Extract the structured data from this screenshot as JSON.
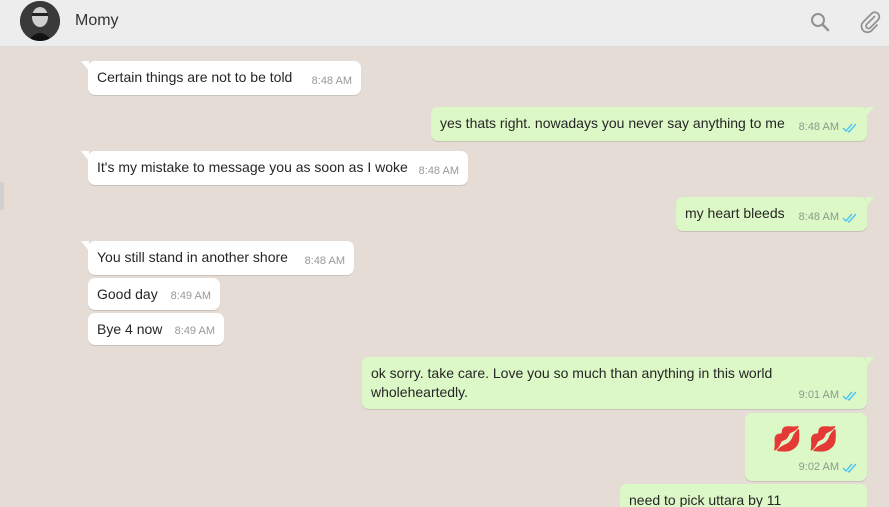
{
  "header": {
    "contact_name": "Momy",
    "icons": [
      "search-icon",
      "attach-icon"
    ]
  },
  "messages": [
    {
      "dir": "in",
      "text": "Certain things are not to be told",
      "time": "8:48 AM"
    },
    {
      "dir": "out",
      "text": "yes thats right. nowadays you never say anything to me",
      "time": "8:48 AM",
      "status": "read"
    },
    {
      "dir": "in",
      "text": "It's my mistake to message you as soon as I woke",
      "time": "8:48 AM"
    },
    {
      "dir": "out",
      "text": "my heart bleeds",
      "time": "8:48 AM",
      "status": "read"
    },
    {
      "dir": "in",
      "text": "You still stand in another shore",
      "time": "8:48 AM"
    },
    {
      "dir": "in",
      "text": "Good day",
      "time": "8:49 AM"
    },
    {
      "dir": "in",
      "text": "Bye 4 now",
      "time": "8:49 AM"
    },
    {
      "dir": "out",
      "text": "ok sorry. take care. Love you so much than anything in this world wholeheartedly.",
      "time": "9:01 AM",
      "status": "read"
    },
    {
      "dir": "out",
      "text": "💋 💋",
      "time": "9:02 AM",
      "status": "read",
      "emoji": true
    },
    {
      "dir": "out",
      "text": "need to pick uttara by 11",
      "time": "",
      "status": "partial"
    }
  ],
  "colors": {
    "incoming_bubble": "#ffffff",
    "outgoing_bubble": "#dcf8c6",
    "chat_background": "#e5ddd5",
    "header_background": "#ededed",
    "read_ticks": "#4fc3f7"
  }
}
